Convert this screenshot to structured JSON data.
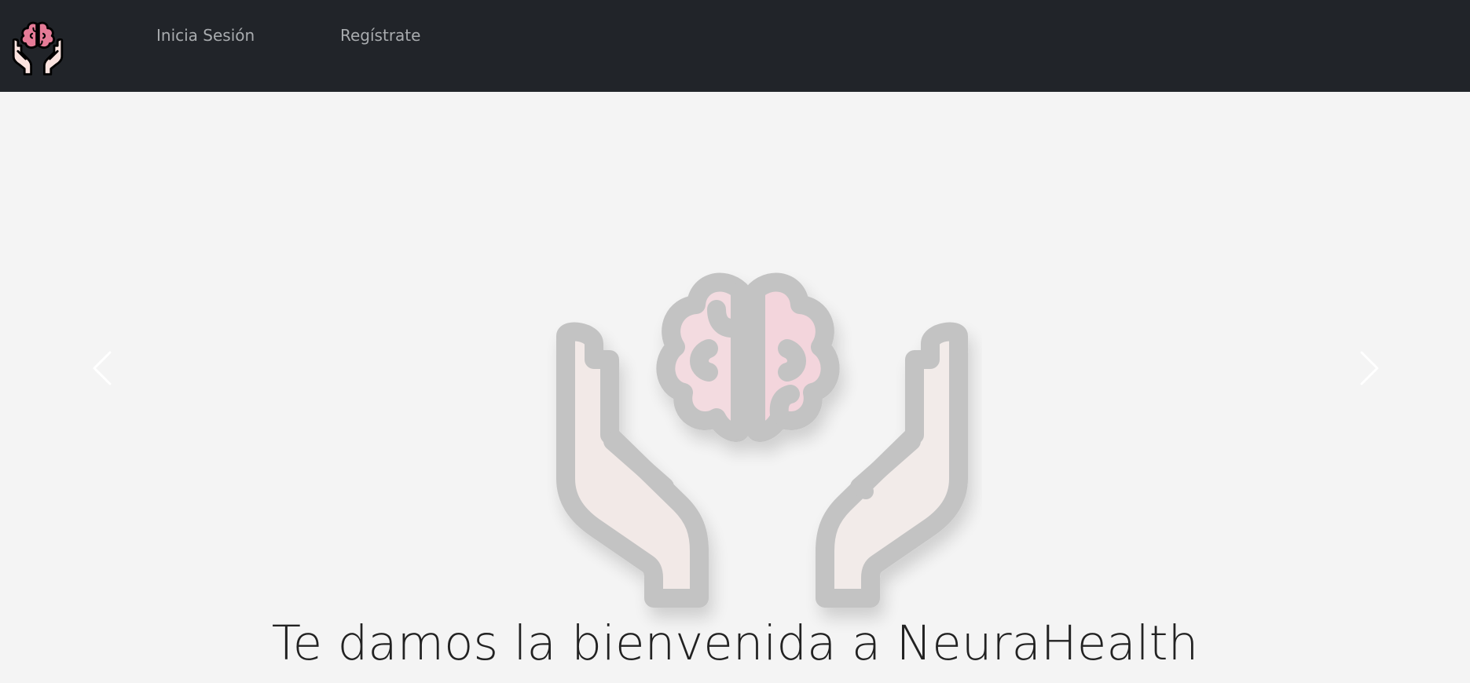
{
  "app": {
    "brand_icon": "hands-brain-logo-icon"
  },
  "navbar": {
    "links": [
      {
        "label": "Inicia Sesión"
      },
      {
        "label": "Regístrate"
      }
    ],
    "background": "#212429",
    "link_color": "#a8abae"
  },
  "carousel": {
    "image_icon": "hands-holding-brain-icon",
    "prev_icon": "chevron-left-icon",
    "next_icon": "chevron-right-icon"
  },
  "hero": {
    "heading": "Te damos la bienvenida a NeuraHealth"
  },
  "colors": {
    "page_background": "#f4f4f4",
    "brain_pink": "#f3cfd6",
    "hand_fill": "#f2e9e7",
    "outline_gray": "#c3c3c3",
    "logo_pink": "#e57b97",
    "logo_hand": "#fbe3df"
  }
}
